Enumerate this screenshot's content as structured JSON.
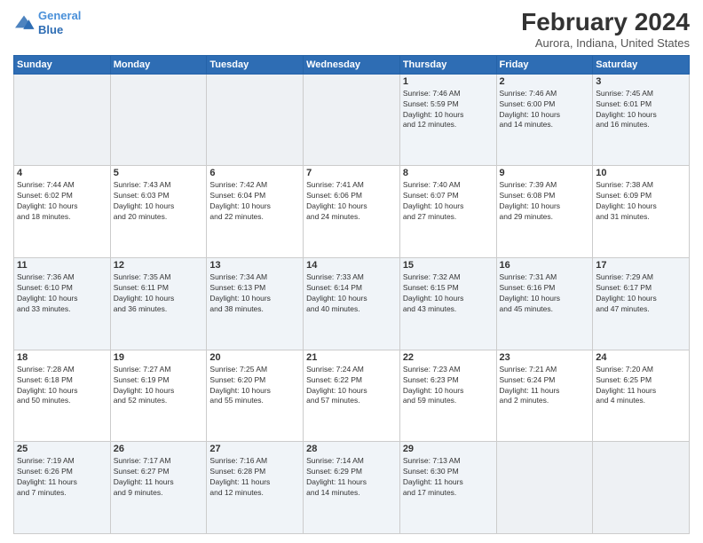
{
  "header": {
    "logo_line1": "General",
    "logo_line2": "Blue",
    "main_title": "February 2024",
    "subtitle": "Aurora, Indiana, United States"
  },
  "days_of_week": [
    "Sunday",
    "Monday",
    "Tuesday",
    "Wednesday",
    "Thursday",
    "Friday",
    "Saturday"
  ],
  "weeks": [
    [
      {
        "day": "",
        "info": ""
      },
      {
        "day": "",
        "info": ""
      },
      {
        "day": "",
        "info": ""
      },
      {
        "day": "",
        "info": ""
      },
      {
        "day": "1",
        "info": "Sunrise: 7:46 AM\nSunset: 5:59 PM\nDaylight: 10 hours\nand 12 minutes."
      },
      {
        "day": "2",
        "info": "Sunrise: 7:46 AM\nSunset: 6:00 PM\nDaylight: 10 hours\nand 14 minutes."
      },
      {
        "day": "3",
        "info": "Sunrise: 7:45 AM\nSunset: 6:01 PM\nDaylight: 10 hours\nand 16 minutes."
      }
    ],
    [
      {
        "day": "4",
        "info": "Sunrise: 7:44 AM\nSunset: 6:02 PM\nDaylight: 10 hours\nand 18 minutes."
      },
      {
        "day": "5",
        "info": "Sunrise: 7:43 AM\nSunset: 6:03 PM\nDaylight: 10 hours\nand 20 minutes."
      },
      {
        "day": "6",
        "info": "Sunrise: 7:42 AM\nSunset: 6:04 PM\nDaylight: 10 hours\nand 22 minutes."
      },
      {
        "day": "7",
        "info": "Sunrise: 7:41 AM\nSunset: 6:06 PM\nDaylight: 10 hours\nand 24 minutes."
      },
      {
        "day": "8",
        "info": "Sunrise: 7:40 AM\nSunset: 6:07 PM\nDaylight: 10 hours\nand 27 minutes."
      },
      {
        "day": "9",
        "info": "Sunrise: 7:39 AM\nSunset: 6:08 PM\nDaylight: 10 hours\nand 29 minutes."
      },
      {
        "day": "10",
        "info": "Sunrise: 7:38 AM\nSunset: 6:09 PM\nDaylight: 10 hours\nand 31 minutes."
      }
    ],
    [
      {
        "day": "11",
        "info": "Sunrise: 7:36 AM\nSunset: 6:10 PM\nDaylight: 10 hours\nand 33 minutes."
      },
      {
        "day": "12",
        "info": "Sunrise: 7:35 AM\nSunset: 6:11 PM\nDaylight: 10 hours\nand 36 minutes."
      },
      {
        "day": "13",
        "info": "Sunrise: 7:34 AM\nSunset: 6:13 PM\nDaylight: 10 hours\nand 38 minutes."
      },
      {
        "day": "14",
        "info": "Sunrise: 7:33 AM\nSunset: 6:14 PM\nDaylight: 10 hours\nand 40 minutes."
      },
      {
        "day": "15",
        "info": "Sunrise: 7:32 AM\nSunset: 6:15 PM\nDaylight: 10 hours\nand 43 minutes."
      },
      {
        "day": "16",
        "info": "Sunrise: 7:31 AM\nSunset: 6:16 PM\nDaylight: 10 hours\nand 45 minutes."
      },
      {
        "day": "17",
        "info": "Sunrise: 7:29 AM\nSunset: 6:17 PM\nDaylight: 10 hours\nand 47 minutes."
      }
    ],
    [
      {
        "day": "18",
        "info": "Sunrise: 7:28 AM\nSunset: 6:18 PM\nDaylight: 10 hours\nand 50 minutes."
      },
      {
        "day": "19",
        "info": "Sunrise: 7:27 AM\nSunset: 6:19 PM\nDaylight: 10 hours\nand 52 minutes."
      },
      {
        "day": "20",
        "info": "Sunrise: 7:25 AM\nSunset: 6:20 PM\nDaylight: 10 hours\nand 55 minutes."
      },
      {
        "day": "21",
        "info": "Sunrise: 7:24 AM\nSunset: 6:22 PM\nDaylight: 10 hours\nand 57 minutes."
      },
      {
        "day": "22",
        "info": "Sunrise: 7:23 AM\nSunset: 6:23 PM\nDaylight: 10 hours\nand 59 minutes."
      },
      {
        "day": "23",
        "info": "Sunrise: 7:21 AM\nSunset: 6:24 PM\nDaylight: 11 hours\nand 2 minutes."
      },
      {
        "day": "24",
        "info": "Sunrise: 7:20 AM\nSunset: 6:25 PM\nDaylight: 11 hours\nand 4 minutes."
      }
    ],
    [
      {
        "day": "25",
        "info": "Sunrise: 7:19 AM\nSunset: 6:26 PM\nDaylight: 11 hours\nand 7 minutes."
      },
      {
        "day": "26",
        "info": "Sunrise: 7:17 AM\nSunset: 6:27 PM\nDaylight: 11 hours\nand 9 minutes."
      },
      {
        "day": "27",
        "info": "Sunrise: 7:16 AM\nSunset: 6:28 PM\nDaylight: 11 hours\nand 12 minutes."
      },
      {
        "day": "28",
        "info": "Sunrise: 7:14 AM\nSunset: 6:29 PM\nDaylight: 11 hours\nand 14 minutes."
      },
      {
        "day": "29",
        "info": "Sunrise: 7:13 AM\nSunset: 6:30 PM\nDaylight: 11 hours\nand 17 minutes."
      },
      {
        "day": "",
        "info": ""
      },
      {
        "day": "",
        "info": ""
      }
    ]
  ]
}
